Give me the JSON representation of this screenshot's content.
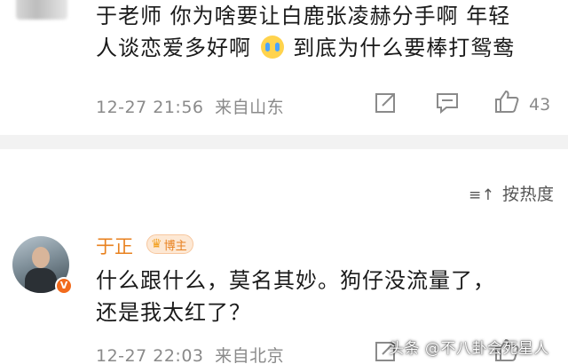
{
  "comment1": {
    "text_line1": "于老师 你为啥要让白鹿张凌赫分手啊 年轻",
    "text_line2a": "人谈恋爱多好啊",
    "emoji": "crying-face",
    "text_line2b": "到底为什么要棒打鸳鸯",
    "timestamp": "12-27 21:56",
    "location": "来自山东",
    "like_count": "43"
  },
  "sort": {
    "icon": "≡↑",
    "label": "按热度"
  },
  "comment2": {
    "username": "于正",
    "badge": "博主",
    "text_line1": "什么跟什么，莫名其妙。狗仔没流量了，",
    "text_line2": "还是我太红了？",
    "timestamp": "12-27 22:03",
    "location": "来自北京"
  },
  "watermark": "头条 @不八卦会死星人",
  "colors": {
    "accent_orange": "#e8811f",
    "meta_gray": "#8a8a8a",
    "separator": "#f2f2f2"
  }
}
